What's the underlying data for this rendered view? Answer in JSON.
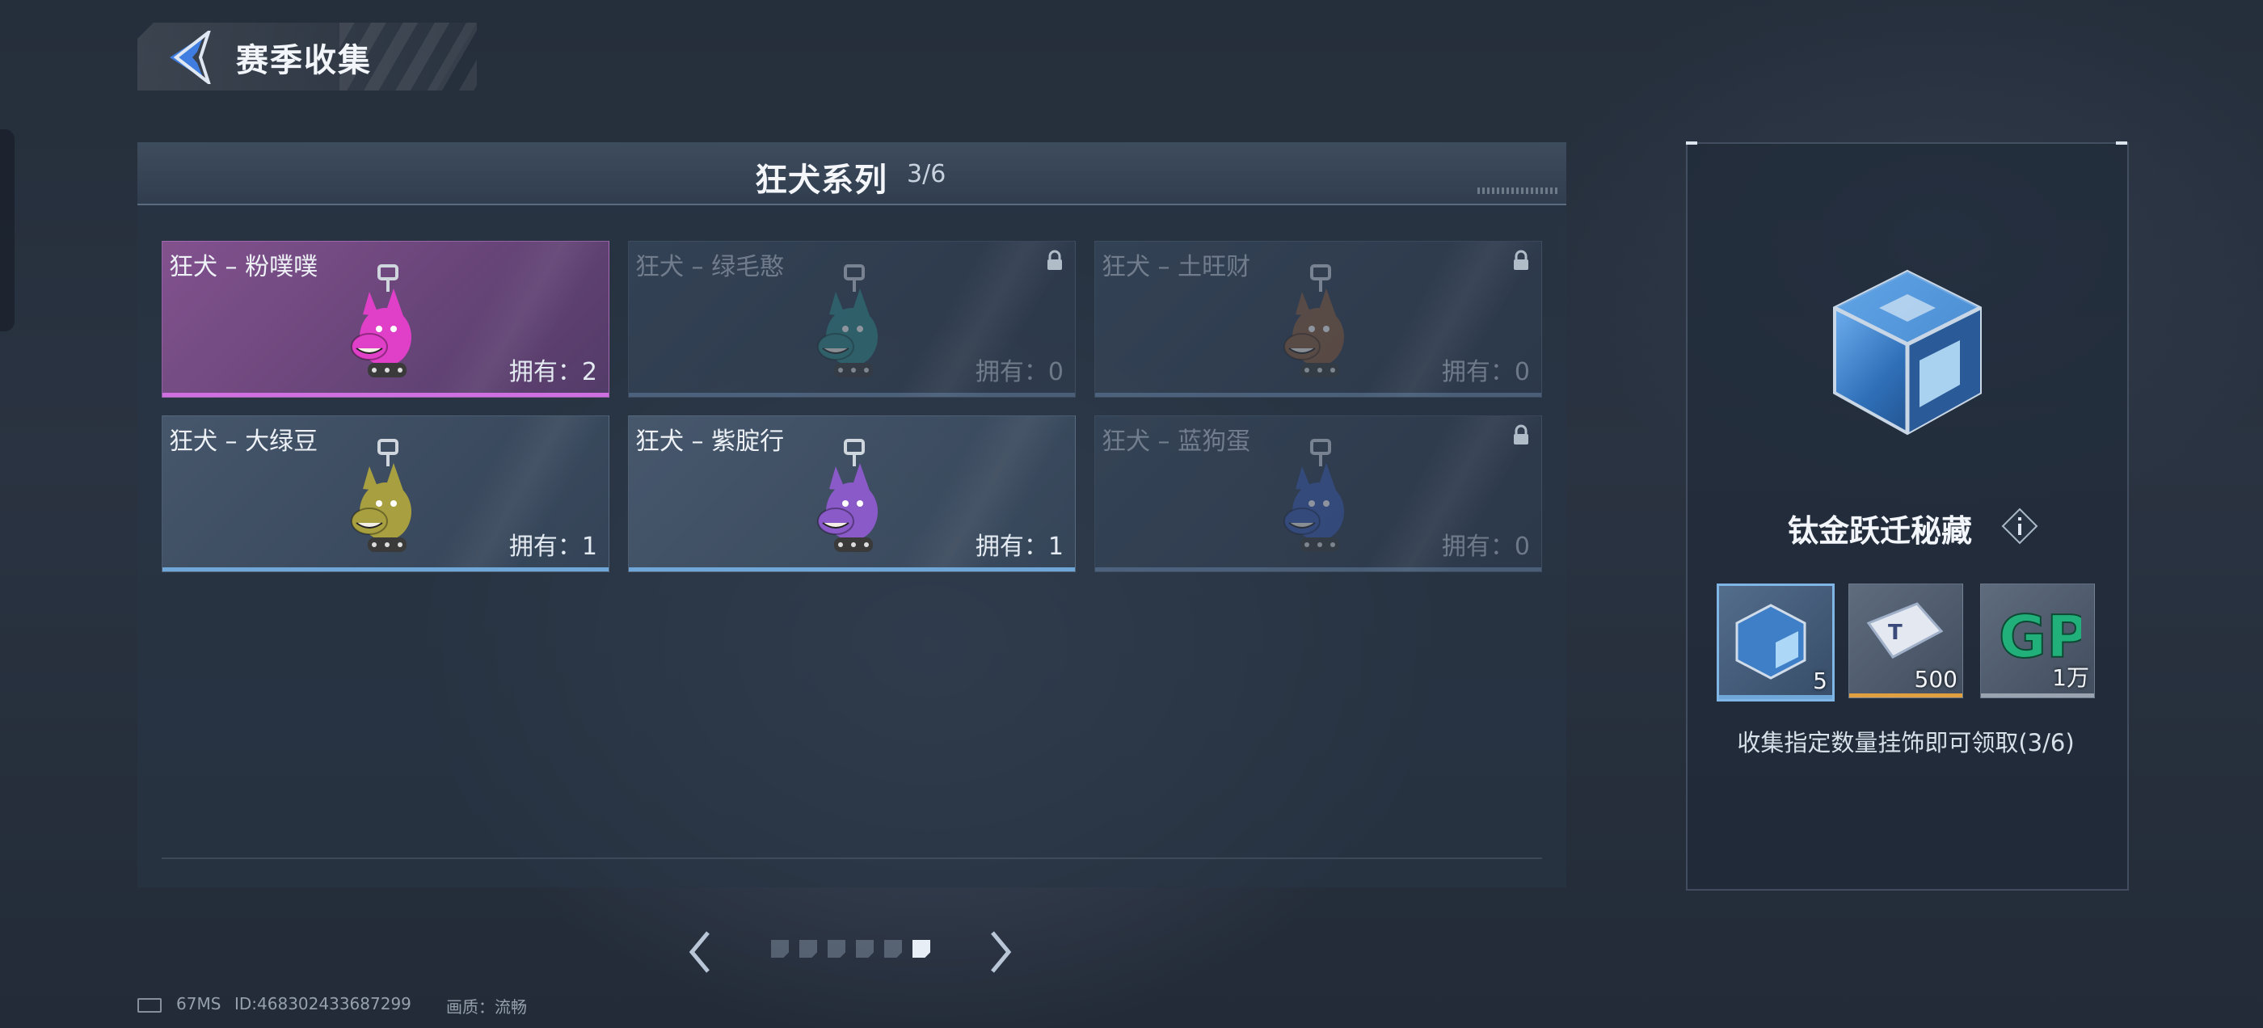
{
  "header": {
    "title": "赛季收集"
  },
  "series": {
    "title": "狂犬系列",
    "count": "3/6"
  },
  "cards": [
    {
      "name": "狂犬 – 粉噗噗",
      "owned": "拥有：2",
      "locked": false,
      "color": "#e040c8"
    },
    {
      "name": "狂犬 – 绿毛憨",
      "owned": "拥有：0",
      "locked": true,
      "color": "#2f8a8a"
    },
    {
      "name": "狂犬 – 土旺财",
      "owned": "拥有：0",
      "locked": true,
      "color": "#8a5a3a"
    },
    {
      "name": "狂犬 – 大绿豆",
      "owned": "拥有：1",
      "locked": false,
      "color": "#a8a040"
    },
    {
      "name": "狂犬 – 紫腚行",
      "owned": "拥有：1",
      "locked": false,
      "color": "#8a5ac8"
    },
    {
      "name": "狂犬 – 蓝狗蛋",
      "owned": "拥有：0",
      "locked": true,
      "color": "#3a5ab0"
    }
  ],
  "pager": {
    "total": 6,
    "active_index": 5
  },
  "reward": {
    "name": "钛金跃迁秘藏",
    "items": [
      {
        "icon": "titanium-cube-icon",
        "qty": "5",
        "bar_color": "#6fa7d8"
      },
      {
        "icon": "ticket-icon",
        "qty": "500",
        "bar_color": "#e0a040"
      },
      {
        "icon": "gp-coin-icon",
        "qty": "1万",
        "bar_color": "#9aa4b0"
      }
    ],
    "description": "收集指定数量挂饰即可领取(3/6)"
  },
  "status": {
    "ping": "67MS",
    "id": "ID:468302433687299",
    "quality": "画质：流畅"
  }
}
